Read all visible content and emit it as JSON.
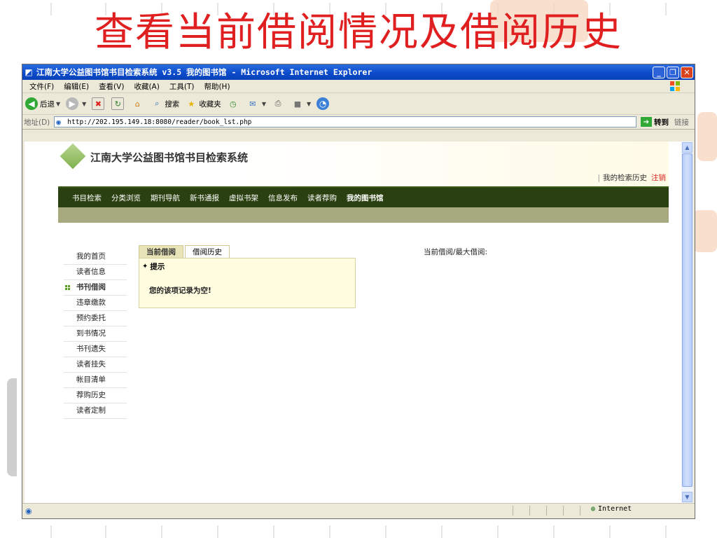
{
  "slide": {
    "title": "查看当前借阅情况及借阅历史"
  },
  "browser": {
    "window_title": "江南大学公益图书馆书目检索系统 v3.5 我的图书馆 - Microsoft Internet Explorer",
    "menus": [
      "文件(F)",
      "编辑(E)",
      "查看(V)",
      "收藏(A)",
      "工具(T)",
      "帮助(H)"
    ],
    "toolbar": {
      "back_label": "后退",
      "search_label": "搜索",
      "favorites_label": "收藏夹"
    },
    "address": {
      "label": "地址(D)",
      "url": "http://202.195.149.18:8080/reader/book_lst.php",
      "go_label": "转到",
      "links_label": "链接"
    },
    "status": {
      "zone": "Internet"
    }
  },
  "site": {
    "name": "江南大学公益图书馆书目检索系统",
    "header_links": {
      "history": "我的检索历史",
      "logout": "注销"
    },
    "nav": [
      "书目检索",
      "分类浏览",
      "期刊导航",
      "新书通报",
      "虚拟书架",
      "信息发布",
      "读者荐购",
      "我的图书馆"
    ],
    "nav_active": "我的图书馆",
    "side_menu": [
      "我的首页",
      "读者信息",
      "书刊借阅",
      "违章缴款",
      "预约委托",
      "到书情况",
      "书刊遗失",
      "读者挂失",
      "帐目清单",
      "荐购历史",
      "读者定制"
    ],
    "side_menu_active": "书刊借阅",
    "tabs": [
      "当前借阅",
      "借阅历史"
    ],
    "tab_active": "当前借阅",
    "panel": {
      "title": "提示",
      "message": "您的该项记录为空!"
    },
    "borrow_status_label": "当前借阅/最大借阅:"
  },
  "colors": {
    "title_red": "#e02020",
    "titlebar_blue": "#0a49c9",
    "nav_green": "#2b4010",
    "subnav_olive": "#a6aa7e",
    "panel_yellow": "#fffce0"
  }
}
